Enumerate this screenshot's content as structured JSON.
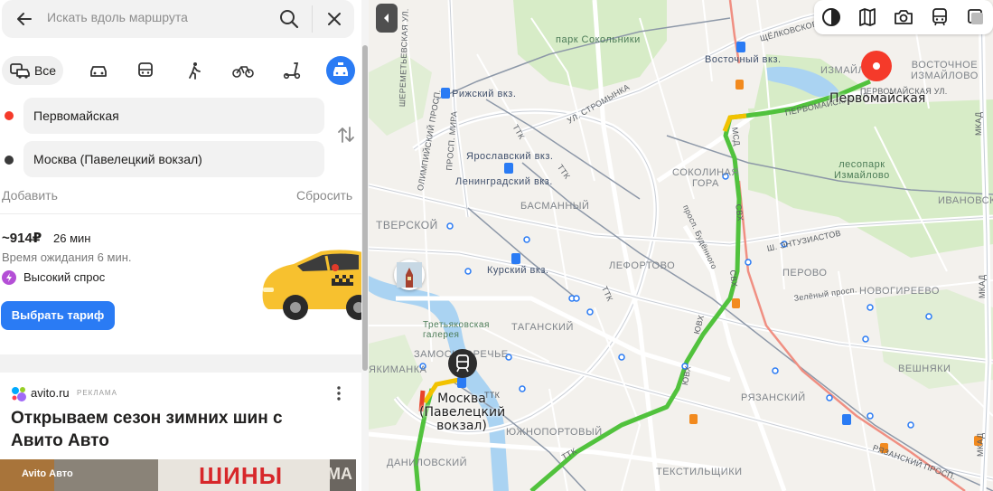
{
  "search": {
    "placeholder": "Искать вдоль маршрута"
  },
  "modes": {
    "all_label": "Все"
  },
  "route": {
    "from": "Первомайская",
    "to": "Москва (Павелецкий вокзал)",
    "add_label": "Добавить",
    "reset_label": "Сбросить"
  },
  "taxi": {
    "price": "~914₽",
    "duration": "26 мин",
    "wait": "Время ожидания 6 мин.",
    "demand": "Высокий спрос",
    "tariff_button": "Выбрать тариф"
  },
  "ad": {
    "domain": "avito.ru",
    "label": "РЕКЛАМА",
    "title": "Открываем сезон зимних шин с Авито Авто",
    "brand": "Avito Авто",
    "sign": "ШИНЫ",
    "sign_more": "МА"
  },
  "map": {
    "labels": {
      "sokolniki_park": "парк Сокольники",
      "vostochny": "Восточный вкз.",
      "shchelkovskoe": "ЩЁЛКОВСКОЕ Ш.",
      "izmaylovo": "ИЗМАЙЛОВО",
      "vostochnoe_izmaylovo": "ВОСТОЧНОЕ\nИЗМАЙЛОВО",
      "pervomayskaya_st": "ПЕРВОМАЙСКАЯ УЛ.",
      "rizhsky": "Рижский вкз.",
      "stromynka": "УЛ. СТРОМЫНКА",
      "sheremetyevskaya": "ШЕРЕМЕТЬЕВСКАЯ УЛ.",
      "prospekt_mira": "ПРОСП. МИРА",
      "olimpiysky": "ОЛИМПИЙСКИЙ ПРОСП.",
      "ttk": "ТТК",
      "mkad": "МКАД",
      "yaroslavsky": "Ярославский вкз.",
      "leningradsky": "Ленинградский вкз.",
      "sokolinaya_gora": "СОКОЛИНАЯ\nГОРА",
      "izmaylovo_forest": "лесопарк\nИзмайлово",
      "basmanny": "БАСМАННЫЙ",
      "svh": "СВХ",
      "mcd": "МСД",
      "budyonnogo": "просп. Будённого",
      "entuziastov": "Ш. ЭНТУЗИАСТОВ",
      "ivanovskoe": "ИВАНОВСКОЕ",
      "tverskoy": "ТВЕРСКОЙ",
      "kursky": "Курский вкз.",
      "lefortovo": "ЛЕФОРТОВО",
      "perovo": "ПЕРОВО",
      "zeleny": "Зелёный просп.",
      "novogireevo": "НОВОГИРЕЕВО",
      "tretyakov": "Третьяковская\nгалерея",
      "tagansky": "ТАГАНСКИЙ",
      "yuvh": "ЮВХ",
      "veshnyaki": "ВЕШНЯКИ",
      "yakimanka": "ЯКИМАНКА",
      "zamoskvorechye": "ЗАМОСКВОРЕЧЬЕ",
      "ryazansky": "РЯЗАНСКИЙ",
      "ryazansky_prosp": "РЯЗАНСКИЙ ПРОСП.",
      "yuzhnoportovy": "ЮЖНОПОРТОВЫЙ",
      "danilovsky": "ДАНИЛОВСКИЙ",
      "tekstilshchiki": "ТЕКСТИЛЬЩИКИ",
      "start": "Первомайская",
      "end": "Москва\n(Павелецкий\nвокзал)"
    }
  },
  "colors": {
    "accent": "#2a7bf4",
    "start": "#f53a2a",
    "route_green": "#51c23d",
    "route_yellow": "#f2c200",
    "route_red": "#e8432a",
    "park": "#d7ecc7",
    "water": "#aad3f2"
  }
}
